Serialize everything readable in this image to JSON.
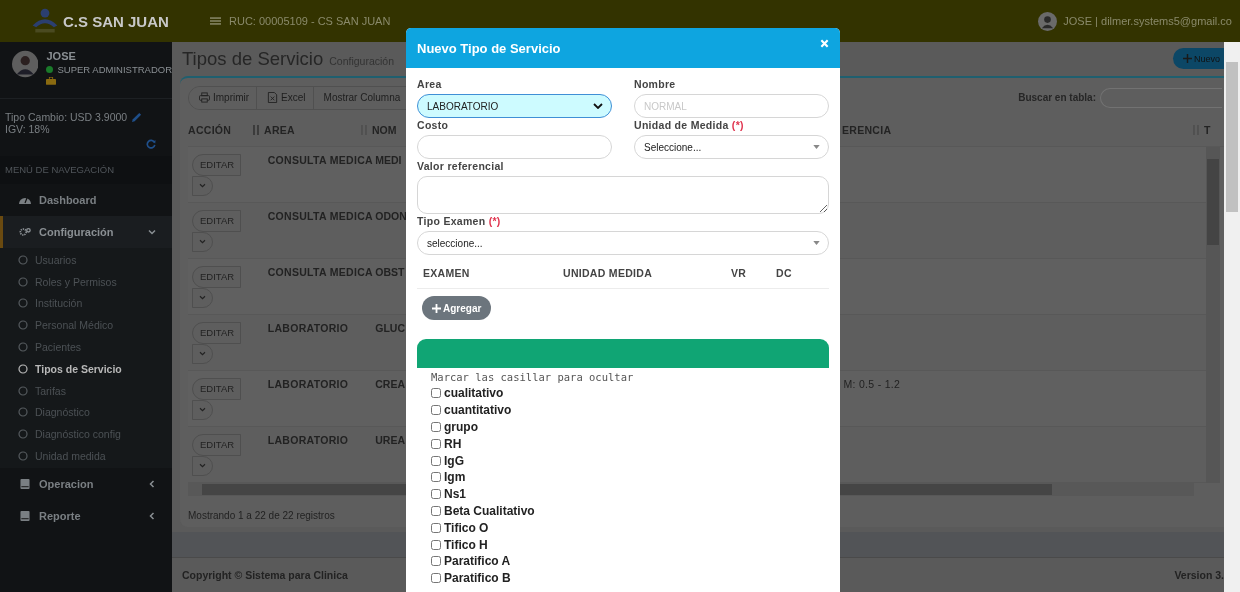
{
  "header": {
    "brand": "C.S SAN JUAN",
    "ruc": "RUC: 00005109 - CS SAN JUAN",
    "user": "JOSE | dilmer.systems5@gmail.co"
  },
  "sidebar": {
    "user_name": "JOSE",
    "role": "SUPER ADMINISTRADOR",
    "exchange": "Tipo Cambio: USD 3.9000",
    "igv": "IGV: 18%",
    "nav_header": "MENÚ DE NAVEGACIÓN",
    "items": [
      {
        "label": "Dashboard",
        "kind": "dashboard"
      },
      {
        "label": "Configuración",
        "kind": "settings",
        "expanded": true,
        "children": [
          {
            "label": "Usuarios",
            "selected": false
          },
          {
            "label": "Roles y Permisos",
            "selected": false
          },
          {
            "label": "Institución",
            "selected": false
          },
          {
            "label": "Personal Médico",
            "selected": false
          },
          {
            "label": "Pacientes",
            "selected": false
          },
          {
            "label": "Tipos de Servicio",
            "selected": true
          },
          {
            "label": "Tarifas",
            "selected": false
          },
          {
            "label": "Diagnóstico",
            "selected": false
          },
          {
            "label": "Diagnóstico config",
            "selected": false
          },
          {
            "label": "Unidad medida",
            "selected": false
          }
        ]
      },
      {
        "label": "Operacion",
        "kind": "book",
        "expanded": false
      },
      {
        "label": "Reporte",
        "kind": "book",
        "expanded": false
      }
    ]
  },
  "page": {
    "title": "Tipos de Servicio",
    "subtitle": "Configuración",
    "new_button": "Nuevo"
  },
  "toolbar": [
    {
      "label": "Imprimir",
      "kind": "print"
    },
    {
      "label": "Excel",
      "kind": "excel"
    },
    {
      "label": "Mostrar Columna",
      "kind": "text"
    }
  ],
  "search": {
    "label": "Buscar en tabla:"
  },
  "table": {
    "columns": [
      "ACCIÓN",
      "AREA",
      "NOM",
      "ERENCIA",
      "T"
    ],
    "rows": [
      {
        "action": "EDITAR",
        "area": "CONSULTA MEDICA",
        "name": "MEDI",
        "reference": ""
      },
      {
        "action": "EDITAR",
        "area": "CONSULTA MEDICA",
        "name": "ODON",
        "reference": ""
      },
      {
        "action": "EDITAR",
        "area": "CONSULTA MEDICA",
        "name": "OBST",
        "reference": ""
      },
      {
        "action": "EDITAR",
        "area": "LABORATORIO",
        "name": "GLUC",
        "reference": ""
      },
      {
        "action": "EDITAR",
        "area": "LABORATORIO",
        "name": "CREA",
        "reference": "M: 0.5 - 1.2"
      },
      {
        "action": "EDITAR",
        "area": "LABORATORIO",
        "name": "UREA",
        "reference": ""
      }
    ]
  },
  "table_info": "Mostrando 1 a 22 de 22 registros",
  "footer": {
    "copyright": "Copyright © Sistema para Clinica",
    "version": "Version 3."
  },
  "modal": {
    "title": "Nuevo Tipo de Servicio",
    "area": {
      "label": "Area",
      "value": "LABORATORIO"
    },
    "nombre": {
      "label": "Nombre",
      "placeholder": "NORMAL"
    },
    "costo": {
      "label": "Costo"
    },
    "unidad": {
      "label": "Unidad de Medida",
      "required_mark": "(*)",
      "value": "Seleccione..."
    },
    "valor": {
      "label": "Valor referencial"
    },
    "tipo": {
      "label": "Tipo Examen",
      "required_mark": "(*)",
      "value": "seleccione..."
    },
    "columns": [
      "EXAMEN",
      "UNIDAD MEDIDA",
      "VR",
      "DC"
    ],
    "add_button": "Agregar",
    "hint": "Marcar las casillar para ocultar",
    "checks": [
      {
        "label": "cualitativo",
        "checked": false
      },
      {
        "label": "cuantitativo",
        "checked": false
      },
      {
        "label": "grupo",
        "checked": false
      },
      {
        "label": "RH",
        "checked": false
      },
      {
        "label": "IgG",
        "checked": false
      },
      {
        "label": "Igm",
        "checked": false
      },
      {
        "label": "Ns1",
        "checked": false
      },
      {
        "label": "Beta Cualitativo",
        "checked": false
      },
      {
        "label": "Tifico O",
        "checked": false
      },
      {
        "label": "Tifico H",
        "checked": false
      },
      {
        "label": "Paratifico A",
        "checked": false
      },
      {
        "label": "Paratifico B",
        "checked": false
      }
    ]
  }
}
